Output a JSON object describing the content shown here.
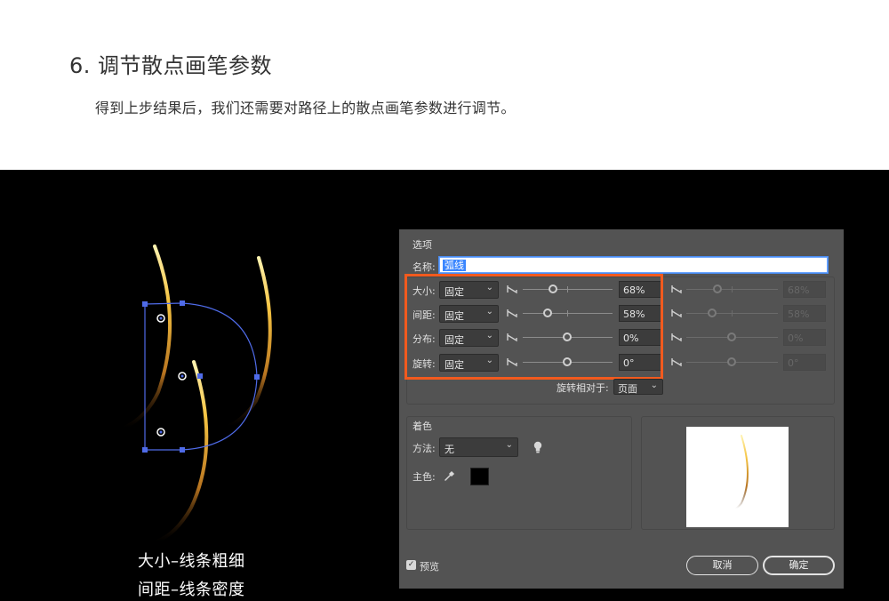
{
  "article": {
    "heading": "6. 调节散点画笔参数",
    "subtext": "得到上步结果后，我们还需要对路径上的散点画笔参数进行调节。"
  },
  "captions": [
    "大小–线条粗细",
    "间距–线条密度"
  ],
  "dialog": {
    "section_options": "选项",
    "name_label": "名称:",
    "name_value": "弧线",
    "rows": [
      {
        "label": "大小:",
        "mode": "固定",
        "value": "68%",
        "value2": "68%"
      },
      {
        "label": "间距:",
        "mode": "固定",
        "value": "58%",
        "value2": "58%"
      },
      {
        "label": "分布:",
        "mode": "固定",
        "value": "0%",
        "value2": "0%"
      },
      {
        "label": "旋转:",
        "mode": "固定",
        "value": "0°",
        "value2": "0°"
      }
    ],
    "rotate_relative_label": "旋转相对于:",
    "rotate_relative_value": "页面",
    "section_coloring": "着色",
    "method_label": "方法:",
    "method_value": "无",
    "key_color_label": "主色:",
    "key_color": "#000000",
    "preview_label": "预览",
    "cancel_label": "取消",
    "ok_label": "确定"
  },
  "colors": {
    "highlight": "#f25a1e",
    "selection_path": "#4f6be8",
    "stroke_gold": "#f5c443",
    "dialog_bg": "#535353"
  },
  "icons": {
    "slider_pressure": "pressure-icon",
    "tip": "lightbulb-icon",
    "eyedropper": "eyedropper-icon",
    "dropdown": "chevron-down-icon",
    "checkbox": "checkbox-checked-icon"
  }
}
